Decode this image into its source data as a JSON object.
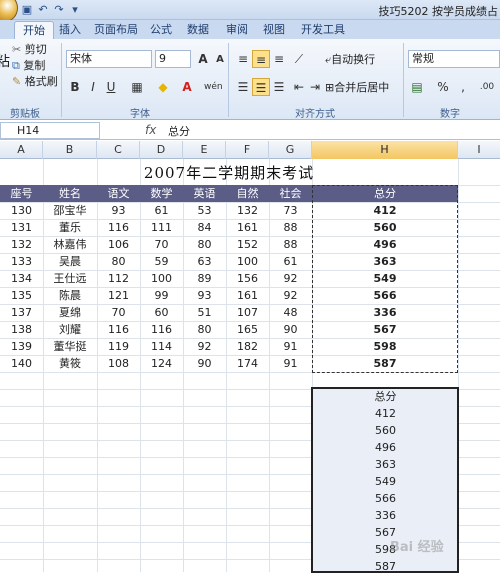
{
  "title_bar": {
    "app_title": "技巧5202 按学员成绩占",
    "qat_icons": [
      "save-icon",
      "undo-icon",
      "redo-icon",
      "customize-icon"
    ]
  },
  "tabs": [
    "开始",
    "插入",
    "页面布局",
    "公式",
    "数据",
    "审阅",
    "视图",
    "开发工具"
  ],
  "ribbon": {
    "clipboard": {
      "cut": "剪切",
      "copy": "复制",
      "format_painter": "格式刷",
      "label": "剪贴板",
      "paste_partial": "粘"
    },
    "font": {
      "name": "宋体",
      "size": "9",
      "label": "字体",
      "grow": "A",
      "shrink": "A",
      "bold": "B",
      "italic": "I",
      "underline": "U",
      "wen": "wén"
    },
    "alignment": {
      "wrap": "自动换行",
      "merge": "合并后居中",
      "label": "对齐方式"
    },
    "number": {
      "format": "常规",
      "label": "数字",
      "percent": "%",
      "comma": ",",
      "inc_dec": ".00"
    }
  },
  "formula_bar": {
    "name_box": "H14",
    "fx": "fx",
    "content": "总分"
  },
  "columns": [
    "A",
    "B",
    "C",
    "D",
    "E",
    "F",
    "G",
    "H",
    "I"
  ],
  "sheet": {
    "title": "2007年二学期期末考试",
    "headers": [
      "座号",
      "姓名",
      "语文",
      "数学",
      "英语",
      "自然",
      "社会",
      "总分"
    ],
    "rows": [
      [
        "130",
        "邵宝华",
        "93",
        "61",
        "53",
        "132",
        "73",
        "412"
      ],
      [
        "131",
        "董乐",
        "116",
        "111",
        "84",
        "161",
        "88",
        "560"
      ],
      [
        "132",
        "林嘉伟",
        "106",
        "70",
        "80",
        "152",
        "88",
        "496"
      ],
      [
        "133",
        "吴晨",
        "80",
        "59",
        "63",
        "100",
        "61",
        "363"
      ],
      [
        "134",
        "王仕远",
        "112",
        "100",
        "89",
        "156",
        "92",
        "549"
      ],
      [
        "135",
        "陈晨",
        "121",
        "99",
        "93",
        "161",
        "92",
        "566"
      ],
      [
        "137",
        "夏绵",
        "70",
        "60",
        "51",
        "107",
        "48",
        "336"
      ],
      [
        "138",
        "刘耀",
        "116",
        "116",
        "80",
        "165",
        "90",
        "567"
      ],
      [
        "139",
        "董华挺",
        "119",
        "114",
        "92",
        "182",
        "91",
        "598"
      ],
      [
        "140",
        "黄筱",
        "108",
        "124",
        "90",
        "174",
        "91",
        "587"
      ]
    ],
    "copied_header": "总分",
    "copied_values": [
      "412",
      "560",
      "496",
      "363",
      "549",
      "566",
      "336",
      "567",
      "598",
      "587"
    ]
  },
  "watermark": "Bai 经验",
  "colors": {
    "header_fill": "#5b5d86",
    "copy_fill": "#e9eef7",
    "ribbon_bg": "#dce7f5"
  }
}
